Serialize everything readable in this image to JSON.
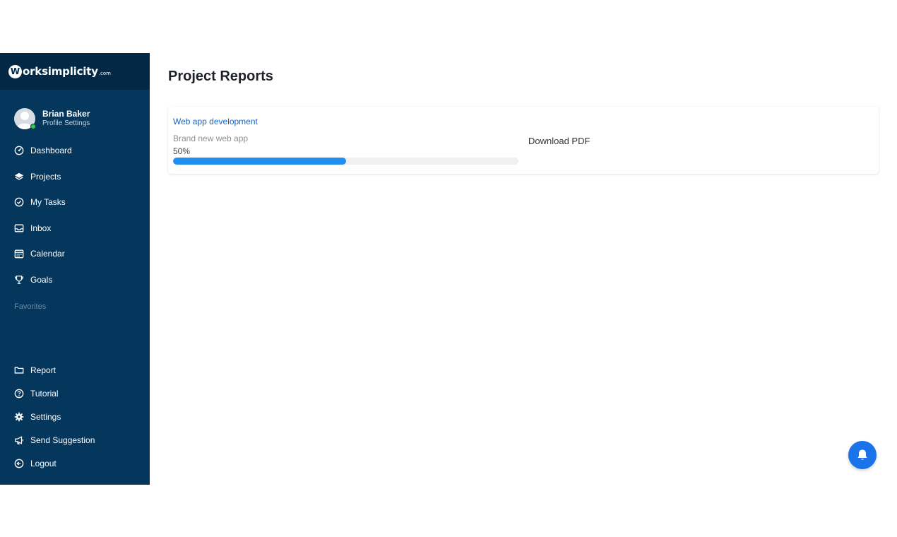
{
  "brand": {
    "mark": "W",
    "name": "orksimplicity",
    "suffix": ".com"
  },
  "profile": {
    "name": "Brian Baker",
    "subtitle": "Profile Settings",
    "status": "online"
  },
  "nav": [
    {
      "label": "Dashboard",
      "icon": "gauge-icon"
    },
    {
      "label": "Projects",
      "icon": "layers-icon"
    },
    {
      "label": "My Tasks",
      "icon": "check-circle-icon"
    },
    {
      "label": "Inbox",
      "icon": "inbox-icon"
    },
    {
      "label": "Calendar",
      "icon": "calendar-icon"
    },
    {
      "label": "Goals",
      "icon": "trophy-icon"
    }
  ],
  "favorites_label": "Favorites",
  "bottom_nav": [
    {
      "label": "Report",
      "icon": "report-icon"
    },
    {
      "label": "Tutorial",
      "icon": "question-circle-icon"
    },
    {
      "label": "Settings",
      "icon": "gear-icon"
    },
    {
      "label": "Send Suggestion",
      "icon": "megaphone-icon"
    },
    {
      "label": "Logout",
      "icon": "logout-icon"
    }
  ],
  "page_title": "Project Reports",
  "reports": [
    {
      "title": "Web app development",
      "description": "Brand new web app",
      "progress_text": "50%",
      "progress": 0.5,
      "action": "Download PDF"
    }
  ],
  "colors": {
    "sidebar": "#05365b",
    "sidebar_header": "#022846",
    "accent": "#1f8eed",
    "link": "#1565c0",
    "status_online": "#2ecc40",
    "fab": "#1a73e8"
  },
  "fab_icon": "bell-icon"
}
